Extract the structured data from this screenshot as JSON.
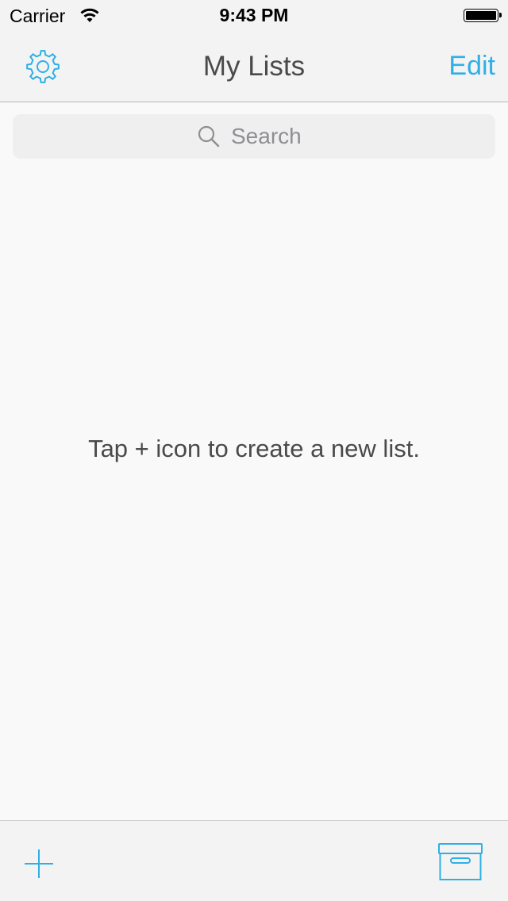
{
  "status_bar": {
    "carrier": "Carrier",
    "time": "9:43 PM",
    "battery_level": 1.0
  },
  "navbar": {
    "title": "My Lists",
    "edit_label": "Edit",
    "left_icon": "gear-icon"
  },
  "search": {
    "placeholder": "Search",
    "value": ""
  },
  "empty_state": {
    "message": "Tap + icon to create a new list."
  },
  "toolbar": {
    "left_icon": "plus-icon",
    "right_icon": "archive-box-icon"
  },
  "colors": {
    "accent": "#2eb0e6",
    "text": "#4a4a4a",
    "bar_bg": "#f3f3f3",
    "page_bg": "#f9f9f9"
  }
}
